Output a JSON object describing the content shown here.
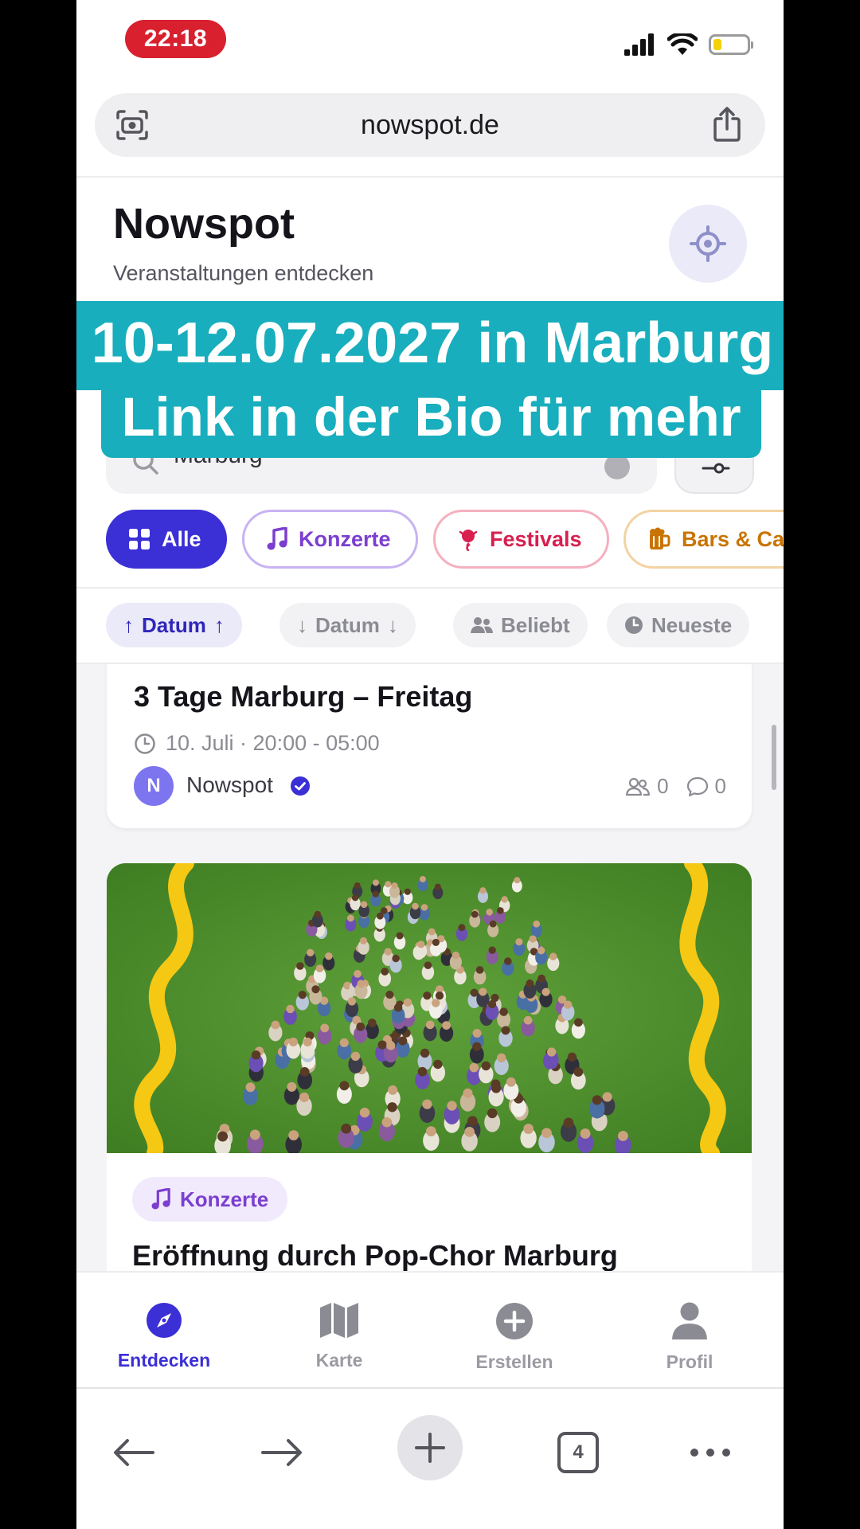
{
  "status_bar": {
    "time": "22:18",
    "battery_level": 0.25
  },
  "browser": {
    "url": "nowspot.de",
    "tab_count": "4"
  },
  "app": {
    "title": "Nowspot",
    "subtitle": "Veranstaltungen entdecken"
  },
  "overlay": {
    "line1": "10-12.07.2027 in Marburg",
    "line2": "Link in der Bio für mehr"
  },
  "search": {
    "value": "Marburg"
  },
  "categories": [
    {
      "label": "Alle",
      "icon": "grid-icon",
      "color": "#3b2fd6",
      "active": true
    },
    {
      "label": "Konzerte",
      "icon": "music-note-icon",
      "color": "#7b3fd0"
    },
    {
      "label": "Festivals",
      "icon": "balloon-icon",
      "color": "#d81f4f"
    },
    {
      "label": "Bars & Ca",
      "icon": "beer-mug-icon",
      "color": "#c97400"
    }
  ],
  "sort": [
    {
      "label": "Datum",
      "icon": "arrow-up-icon",
      "active": true
    },
    {
      "label": "Datum",
      "icon": "arrow-down-icon"
    },
    {
      "label": "Beliebt",
      "icon": "people-icon"
    },
    {
      "label": "Neueste",
      "icon": "clock-icon"
    }
  ],
  "events": [
    {
      "title": "3 Tage Marburg – Freitag",
      "datetime": "10. Juli · 20:00 - 05:00",
      "organizer": "Nowspot",
      "organizer_initial": "N",
      "attendees": "0",
      "comments": "0"
    },
    {
      "tag": "Konzerte",
      "title": "Eröffnung durch Pop-Chor Marburg"
    }
  ],
  "bottom_nav": [
    {
      "label": "Entdecken",
      "icon": "compass-icon",
      "active": true
    },
    {
      "label": "Karte",
      "icon": "map-icon"
    },
    {
      "label": "Erstellen",
      "icon": "plus-circle-icon"
    },
    {
      "label": "Profil",
      "icon": "person-icon"
    }
  ],
  "colors": {
    "primary": "#3b2fd6",
    "overlay": "#19aebd",
    "time_pill": "#d8202f"
  }
}
